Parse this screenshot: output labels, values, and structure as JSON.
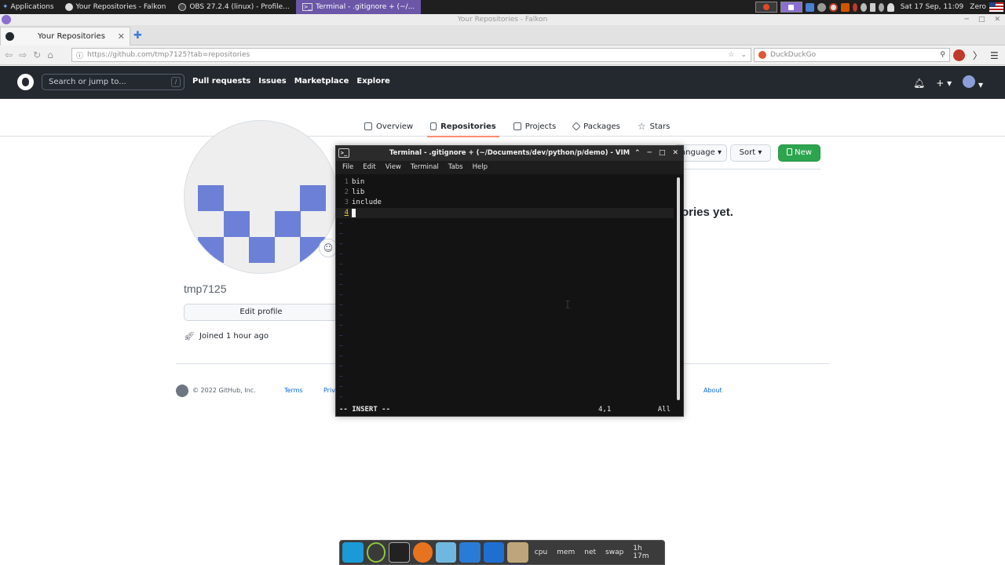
{
  "system_panel": {
    "apps_label": "Applications",
    "tasks": [
      {
        "label": "Your Repositories - Falkon",
        "active": false
      },
      {
        "label": "OBS 27.2.4 (linux) - Profile...",
        "active": false
      },
      {
        "label": "Terminal - .gitignore + (~/...",
        "active": true
      }
    ],
    "clock": "Sat 17 Sep, 11:09",
    "user": "Zero"
  },
  "browser": {
    "window_title": "Your Repositories - Falkon",
    "tab_title": "Your Repositories",
    "url_host": "https://github.com/",
    "url_rest": "tmp7125?tab=repositories",
    "search_placeholder": "DuckDuckGo"
  },
  "github": {
    "search_placeholder": "Search or jump to...",
    "search_shortcut": "/",
    "nav": [
      "Pull requests",
      "Issues",
      "Marketplace",
      "Explore"
    ],
    "profile_tabs": [
      {
        "label": "Overview",
        "icon": "book-icon"
      },
      {
        "label": "Repositories",
        "icon": "repo-icon"
      },
      {
        "label": "Projects",
        "icon": "table-icon"
      },
      {
        "label": "Packages",
        "icon": "package-icon"
      },
      {
        "label": "Stars",
        "icon": "star-icon"
      }
    ],
    "username": "tmp7125",
    "edit_profile": "Edit profile",
    "joined": "Joined 1 hour ago",
    "language_btn": "anguage",
    "sort_btn": "Sort",
    "new_btn": "New",
    "empty_message": "ories yet.",
    "footer": {
      "copyright": "© 2022 GitHub, Inc.",
      "terms": "Terms",
      "privacy": "Priv",
      "about": "About"
    }
  },
  "terminal": {
    "title": "Terminal - .gitignore + (~/Documents/dev/python/p/demo) - VIM",
    "menu": [
      "File",
      "Edit",
      "View",
      "Terminal",
      "Tabs",
      "Help"
    ],
    "lines": [
      {
        "num": "1",
        "text": "bin"
      },
      {
        "num": "2",
        "text": "lib"
      },
      {
        "num": "3",
        "text": "include"
      },
      {
        "num": "4",
        "text": ""
      }
    ],
    "mode": "-- INSERT --",
    "position": "4,1",
    "scroll": "All"
  },
  "dock": {
    "labels": [
      "cpu",
      "mem",
      "net",
      "swap",
      "1h 17m"
    ]
  },
  "colors": {
    "terminal_bg": "#131313",
    "github_header": "#24292f",
    "new_button": "#2da44e",
    "active_tab_underline": "#fd8c73",
    "avatar_pixels": "#6d80d7"
  }
}
